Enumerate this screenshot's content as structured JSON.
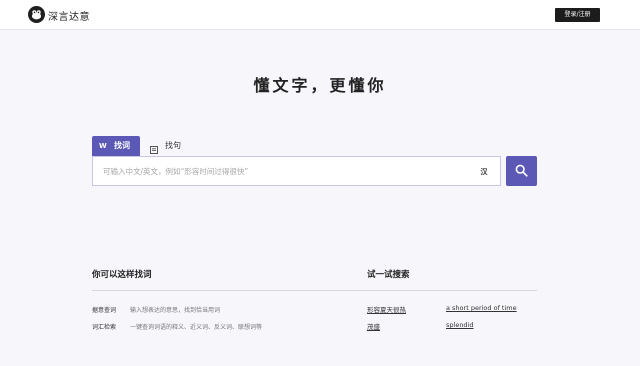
{
  "header": {
    "logo_text": "深言达意",
    "login_label": "登录/注册"
  },
  "hero": {
    "title": "懂文字，更懂你"
  },
  "search": {
    "tabs": [
      {
        "label": "找词",
        "icon": "W",
        "active": true
      },
      {
        "label": "找句",
        "icon": "document-icon",
        "active": false
      }
    ],
    "placeholder": "可输入中文/英文，例如“形容时间过得很快”",
    "lang_toggle": "汉"
  },
  "tips": {
    "title": "你可以这样找词",
    "items": [
      {
        "term": "据意查词",
        "desc": "输入想表达的意思，找到恰当用词"
      },
      {
        "term": "词汇检索",
        "desc": "一键查询词语的释义、近义词、反义词、联想词等"
      }
    ]
  },
  "try": {
    "title": "试一试搜索",
    "links": [
      "形容夏天很热",
      "a short period of time",
      "茂盛",
      "splendid"
    ]
  },
  "colors": {
    "accent": "#5b58b6",
    "header_bg": "#ffffff",
    "page_bg": "#f7f6fb",
    "login_bg": "#1c1c1c"
  }
}
